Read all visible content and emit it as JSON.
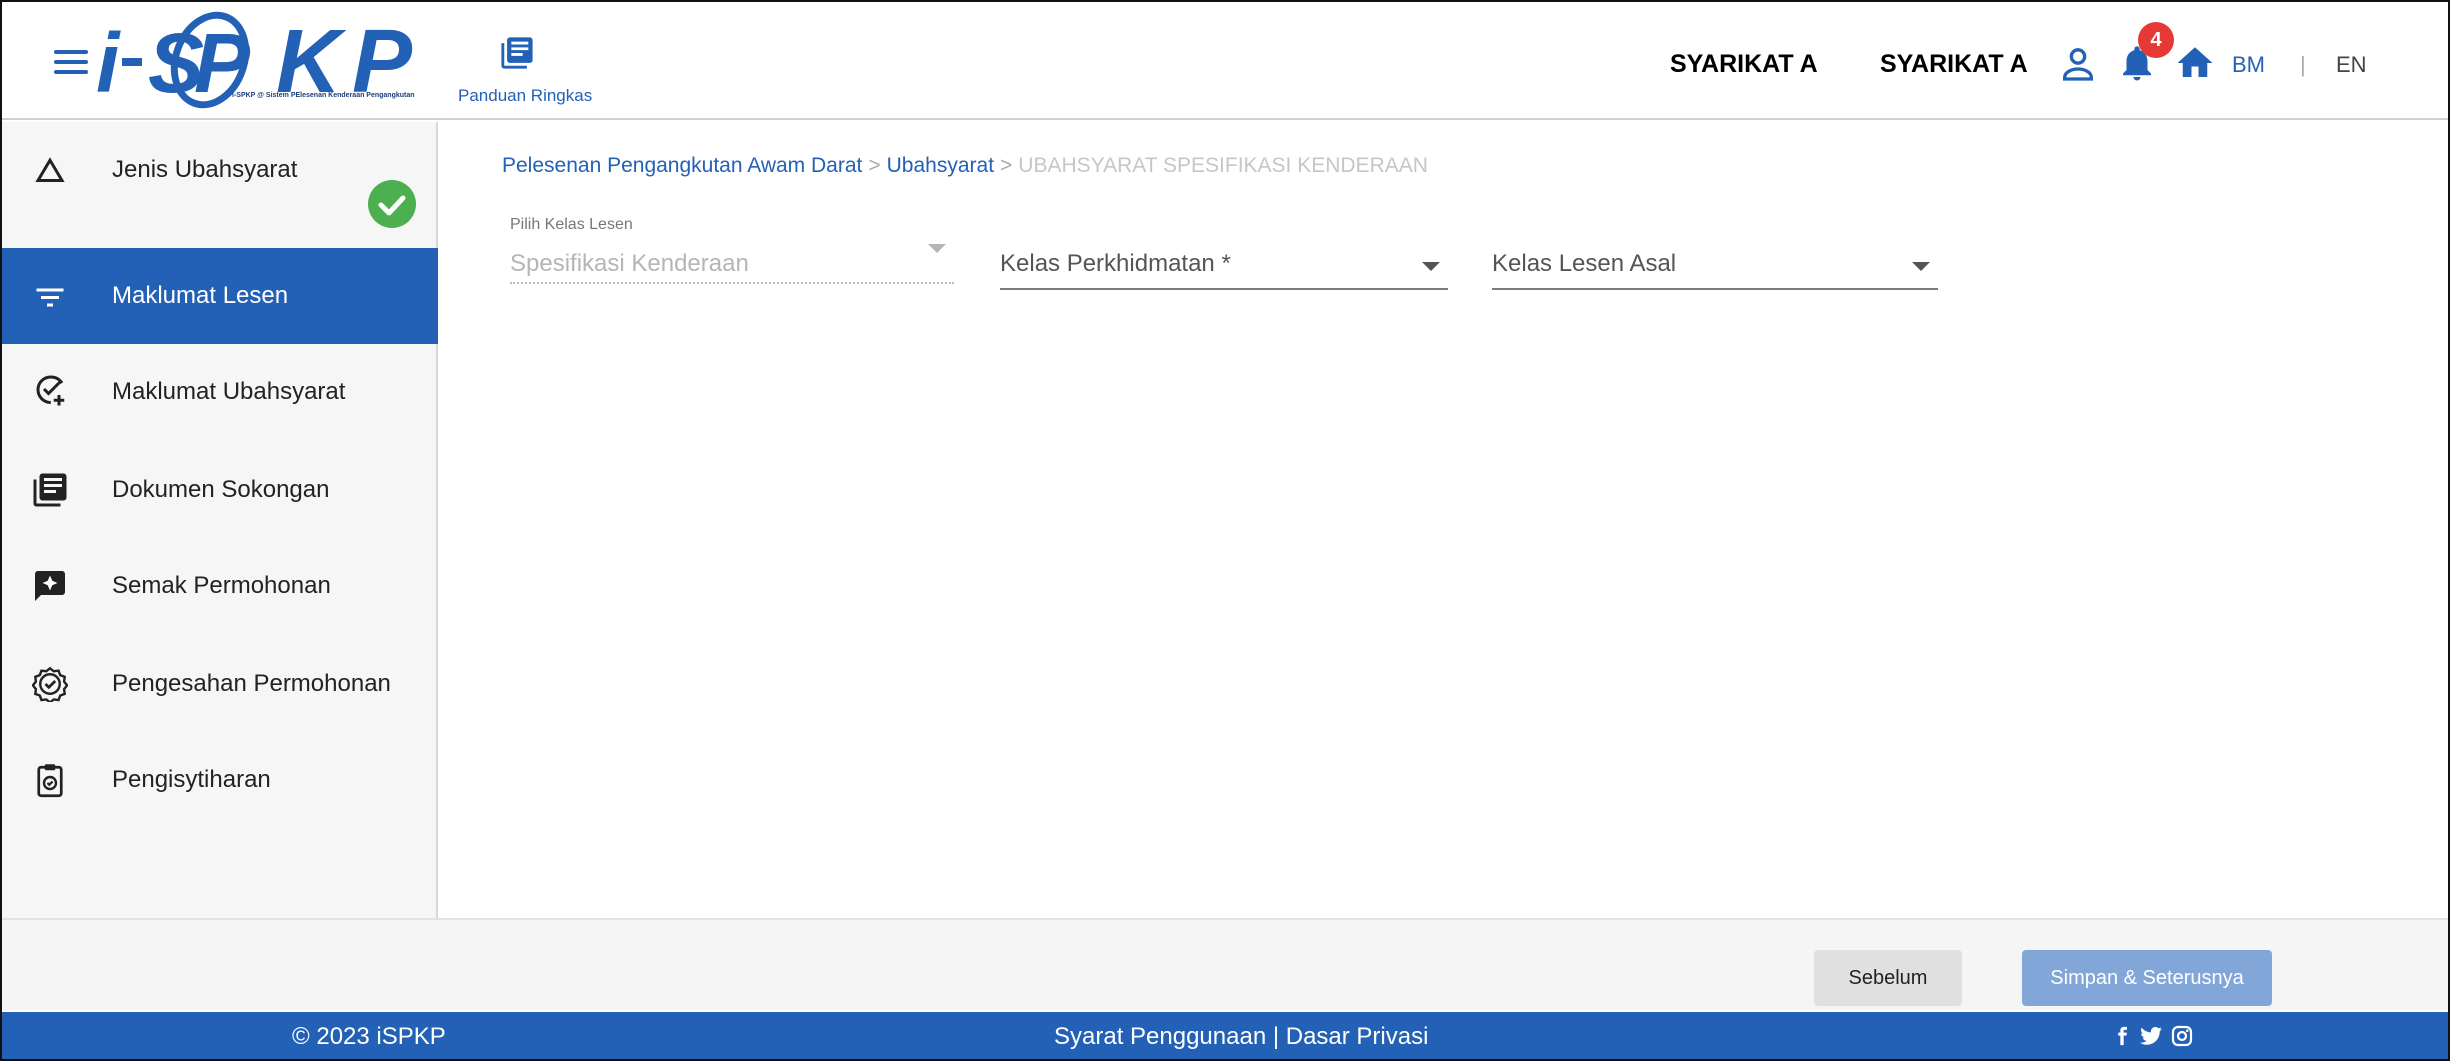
{
  "header": {
    "logo_text": "iSPKP",
    "logo_subtitle": "i-SPKP @ Sistem PElesenan Kenderaan Pengangkutan",
    "guide_label": "Panduan Ringkas",
    "company_name_1": "SYARIKAT A",
    "company_name_2": "SYARIKAT A",
    "notification_count": "4",
    "lang_bm": "BM",
    "lang_separator": "|",
    "lang_en": "EN"
  },
  "sidebar": {
    "items": [
      {
        "label": "Jenis Ubahsyarat",
        "icon": "triangle-icon",
        "completed": true
      },
      {
        "label": "Maklumat Lesen",
        "icon": "filter-icon",
        "active": true
      },
      {
        "label": "Maklumat Ubahsyarat",
        "icon": "check-add-icon"
      },
      {
        "label": "Dokumen Sokongan",
        "icon": "document-icon"
      },
      {
        "label": "Semak Permohonan",
        "icon": "review-icon"
      },
      {
        "label": "Pengesahan Permohonan",
        "icon": "verified-icon"
      },
      {
        "label": "Pengisytiharan",
        "icon": "clipboard-icon"
      }
    ]
  },
  "breadcrumb": {
    "items": [
      "Pelesenan Pengangkutan Awam Darat",
      "Ubahsyarat",
      "UBAHSYARAT SPESIFIKASI KENDERAAN"
    ],
    "separator": ">"
  },
  "form": {
    "field_1": {
      "label": "Pilih Kelas Lesen",
      "value": "Spesifikasi Kenderaan",
      "disabled": true
    },
    "field_2": {
      "value": "Kelas Perkhidmatan *"
    },
    "field_3": {
      "value": "Kelas Lesen Asal"
    }
  },
  "actions": {
    "previous_label": "Sebelum",
    "next_label": "Simpan & Seterusnya"
  },
  "footer": {
    "copyright": "© 2023 iSPKP",
    "terms": "Syarat Penggunaan | Dasar Privasi",
    "social_icons": [
      "facebook-icon",
      "twitter-icon",
      "instagram-icon"
    ]
  },
  "colors": {
    "primary": "#2361b6",
    "badge": "#e53935",
    "success": "#4caf50"
  }
}
